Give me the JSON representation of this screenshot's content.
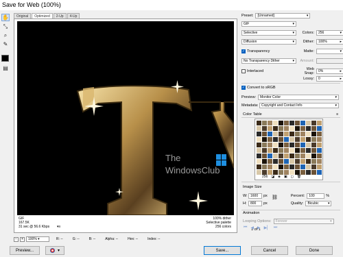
{
  "window": {
    "title": "Save for Web (100%)"
  },
  "tools": [
    {
      "name": "hand-tool-icon",
      "glyph": "✋"
    },
    {
      "name": "slice-select-tool-icon",
      "glyph": "⤡"
    },
    {
      "name": "zoom-tool-icon",
      "glyph": "🔍"
    },
    {
      "name": "eyedropper-tool-icon",
      "glyph": "✎"
    }
  ],
  "tabs": [
    "Original",
    "Optimized",
    "2-Up",
    "4-Up"
  ],
  "canvas": {
    "watermark_line1": "The",
    "watermark_line2": "WindowsClub",
    "letters": "TY"
  },
  "info": {
    "format": "GIF",
    "size": "167.5K",
    "time": "31 sec @ 56.6 Kbps",
    "menu": "▾≡",
    "dither": "100% dither",
    "palette": "Selective palette",
    "colors": "256 colors"
  },
  "statusbar": {
    "zoom": "100%",
    "r": "R: --",
    "g": "G: --",
    "b": "B: --",
    "alpha": "Alpha: --",
    "hex": "Hex: --",
    "index": "Index: --"
  },
  "buttons": {
    "preview": "Preview...",
    "save": "Save...",
    "cancel": "Cancel",
    "done": "Done"
  },
  "panel": {
    "preset_label": "Preset:",
    "preset_value": "[Unnamed]",
    "format_value": "GIF",
    "reduction_value": "Selective",
    "colors_label": "Colors:",
    "colors_value": "256",
    "dither_algo": "Diffusion",
    "dither_label": "Dither:",
    "dither_value": "100%",
    "transparency_label": "Transparency",
    "matte_label": "Matte:",
    "trans_dither_value": "No Transparency Dither",
    "amount_label": "Amount:",
    "interlaced_label": "Interlaced",
    "websnap_label": "Web Snap:",
    "websnap_value": "0%",
    "lossy_label": "Lossy:",
    "lossy_value": "0",
    "convert_label": "Convert to sRGB",
    "preview_label": "Preview:",
    "preview_value": "Monitor Color",
    "metadata_label": "Metadata:",
    "metadata_value": "Copyright and Contact Info",
    "color_table_label": "Color Table",
    "color_count": "256",
    "image_size_label": "Image Size",
    "w_label": "W:",
    "w_value": "1600",
    "h_label": "H:",
    "h_value": "800",
    "px": "px",
    "percent_label": "Percent:",
    "percent_value": "100",
    "percent_sign": "%",
    "quality_label": "Quality:",
    "quality_value": "Bicubic",
    "animation_label": "Animation",
    "looping_label": "Looping Options:",
    "looping_value": "Forever",
    "frame_counter": "1 of 1"
  },
  "colors": {
    "accent": "#0060c0",
    "palette": [
      "#3a2a18",
      "#6b5236",
      "#a08461",
      "#d8c8a8",
      "#1a1208",
      "#c0a070",
      "#2a2a2a",
      "#8a7a5a",
      "#1e64b4",
      "#f0e0c0",
      "#4a3a2a",
      "#7a6040"
    ]
  }
}
